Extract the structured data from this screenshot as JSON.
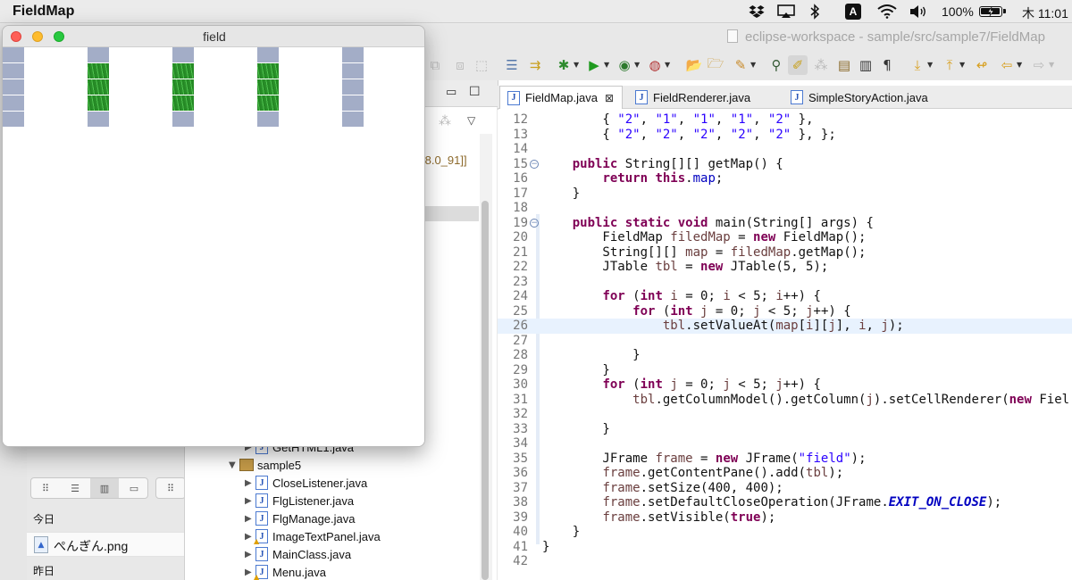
{
  "menubar": {
    "app_name": "FieldMap",
    "icons": [
      "dropbox-icon",
      "airplay-icon",
      "bluetooth-icon",
      "input-source-icon",
      "wifi-icon",
      "volume-icon",
      "battery-icon"
    ],
    "input_source": "A",
    "battery_percent": "100%",
    "battery_level": 1.0,
    "clock": "木 11:01"
  },
  "eclipse": {
    "title": "eclipse-workspace - sample/src/sample7/FieldMap",
    "tabs": [
      {
        "label": "FieldMap.java",
        "active": true
      },
      {
        "label": "FieldRenderer.java",
        "active": false
      },
      {
        "label": "SimpleStoryAction.java",
        "active": false
      }
    ],
    "jre_label": ".8.0_91]]",
    "package_tree": [
      {
        "label": "GetHTML1.java",
        "type": "java",
        "indent": 1,
        "collapsed": true
      },
      {
        "label": "sample5",
        "type": "package",
        "indent": 0,
        "collapsed": false
      },
      {
        "label": "CloseListener.java",
        "type": "java",
        "indent": 1,
        "collapsed": true
      },
      {
        "label": "FlgListener.java",
        "type": "java",
        "indent": 1,
        "collapsed": true
      },
      {
        "label": "FlgManage.java",
        "type": "java",
        "indent": 1,
        "collapsed": true
      },
      {
        "label": "ImageTextPanel.java",
        "type": "java",
        "indent": 1,
        "collapsed": true,
        "warning": true
      },
      {
        "label": "MainClass.java",
        "type": "java",
        "indent": 1,
        "collapsed": true
      },
      {
        "label": "Menu.java",
        "type": "java",
        "indent": 1,
        "collapsed": true,
        "warning": true
      }
    ],
    "code_lines": [
      {
        "n": "12",
        "html": "        { <span class='str'>\"2\"</span>, <span class='str'>\"1\"</span>, <span class='str'>\"1\"</span>, <span class='str'>\"1\"</span>, <span class='str'>\"2\"</span> },"
      },
      {
        "n": "13",
        "html": "        { <span class='str'>\"2\"</span>, <span class='str'>\"2\"</span>, <span class='str'>\"2\"</span>, <span class='str'>\"2\"</span>, <span class='str'>\"2\"</span> }, };"
      },
      {
        "n": "14",
        "html": ""
      },
      {
        "n": "15",
        "fold": true,
        "html": "    <span class='kw'>public</span> String[][] getMap() {"
      },
      {
        "n": "16",
        "html": "        <span class='kw'>return</span> <span class='kw'>this</span>.<span class='fld'>map</span>;"
      },
      {
        "n": "17",
        "html": "    }"
      },
      {
        "n": "18",
        "html": ""
      },
      {
        "n": "19",
        "fold": true,
        "html": "    <span class='kw'>public</span> <span class='kw'>static</span> <span class='kw'>void</span> main(String[] args) {"
      },
      {
        "n": "20",
        "html": "        FieldMap <span class='lv'>filedMap</span> = <span class='kw'>new</span> FieldMap();"
      },
      {
        "n": "21",
        "html": "        String[][] <span class='lv'>map</span> = <span class='lv'>filedMap</span>.getMap();"
      },
      {
        "n": "22",
        "html": "        JTable <span class='lv'>tbl</span> = <span class='kw'>new</span> JTable(5, 5);"
      },
      {
        "n": "23",
        "html": ""
      },
      {
        "n": "24",
        "html": "        <span class='kw'>for</span> (<span class='kw'>int</span> <span class='lv'>i</span> = 0; <span class='lv'>i</span> &lt; 5; <span class='lv'>i</span>++) {"
      },
      {
        "n": "25",
        "html": "            <span class='kw'>for</span> (<span class='kw'>int</span> <span class='lv'>j</span> = 0; <span class='lv'>j</span> &lt; 5; <span class='lv'>j</span>++) {"
      },
      {
        "n": "26",
        "hl": true,
        "html": "                <span class='lv'>tbl</span>.setValueAt(<span class='lv'>map</span>[<span class='lv'>i</span>][<span class='lv'>j</span>], <span class='lv'>i</span>, <span class='lv'>j</span>);"
      },
      {
        "n": "27",
        "html": ""
      },
      {
        "n": "28",
        "html": "            }"
      },
      {
        "n": "29",
        "html": "        }"
      },
      {
        "n": "30",
        "html": "        <span class='kw'>for</span> (<span class='kw'>int</span> <span class='lv'>j</span> = 0; <span class='lv'>j</span> &lt; 5; <span class='lv'>j</span>++) {"
      },
      {
        "n": "31",
        "html": "            <span class='lv'>tbl</span>.getColumnModel().getColumn(<span class='lv'>j</span>).setCellRenderer(<span class='kw'>new</span> Fiel"
      },
      {
        "n": "32",
        "html": ""
      },
      {
        "n": "33",
        "html": "        }"
      },
      {
        "n": "34",
        "html": ""
      },
      {
        "n": "35",
        "html": "        JFrame <span class='lv'>frame</span> = <span class='kw'>new</span> JFrame(<span class='str'>\"field\"</span>);"
      },
      {
        "n": "36",
        "html": "        <span class='lv'>frame</span>.getContentPane().add(<span class='lv'>tbl</span>);"
      },
      {
        "n": "37",
        "html": "        <span class='lv'>frame</span>.setSize(400, 400);"
      },
      {
        "n": "38",
        "html": "        <span class='lv'>frame</span>.setDefaultCloseOperation(JFrame.<span class='sf'>EXIT_ON_CLOSE</span>);"
      },
      {
        "n": "39",
        "html": "        <span class='lv'>frame</span>.setVisible(<span class='kw'>true</span>);"
      },
      {
        "n": "40",
        "html": "    }"
      },
      {
        "n": "41",
        "html": "}"
      },
      {
        "n": "42",
        "html": ""
      }
    ]
  },
  "field_window": {
    "title": "field",
    "grid": [
      [
        "water",
        "white",
        "white",
        "white",
        "white",
        "white",
        "white",
        "white",
        "white",
        "white",
        "white",
        "white",
        "white",
        "white",
        "white",
        "white",
        "white",
        "white",
        "white",
        "white",
        "white",
        "white",
        "white",
        "white",
        "water"
      ],
      [
        "water",
        "white",
        "white",
        "white",
        "grass",
        "white",
        "white",
        "white",
        "grass",
        "white",
        "white",
        "white",
        "grass",
        "white",
        "white",
        "white",
        "grass",
        "white",
        "white",
        "white",
        "water"
      ],
      [
        "water",
        "white",
        "white",
        "white",
        "grass",
        "white",
        "white",
        "white",
        "grass",
        "white",
        "white",
        "white",
        "grass",
        "white",
        "white",
        "white",
        "grass",
        "white",
        "white",
        "white",
        "water"
      ],
      [
        "water",
        "white",
        "white",
        "white",
        "grass",
        "white",
        "white",
        "white",
        "grass",
        "white",
        "white",
        "white",
        "grass",
        "white",
        "white",
        "white",
        "grass",
        "white",
        "white",
        "white",
        "water"
      ],
      [
        "water",
        "white",
        "white",
        "white",
        "white",
        "white",
        "white",
        "white",
        "white",
        "white",
        "white",
        "white",
        "white",
        "white",
        "white",
        "white",
        "white",
        "white",
        "white",
        "white",
        "water"
      ]
    ],
    "columns": [
      {
        "rows": [
          "water",
          "water",
          "water",
          "water",
          "water"
        ]
      },
      {
        "rows": [
          "water",
          "grass",
          "grass",
          "grass",
          "water"
        ]
      },
      {
        "rows": [
          "water",
          "grass",
          "grass",
          "grass",
          "water"
        ]
      },
      {
        "rows": [
          "water",
          "grass",
          "grass",
          "grass",
          "water"
        ]
      },
      {
        "rows": [
          "water",
          "water",
          "water",
          "water",
          "water"
        ]
      }
    ]
  },
  "finder": {
    "today_label": "今日",
    "file_name": "ぺんぎん.png",
    "yesterday_label": "昨日"
  },
  "colors": {
    "water": "#a3adc7",
    "grass": "#2b9a2b",
    "keyword": "#7f0055",
    "string": "#2a00ff"
  }
}
